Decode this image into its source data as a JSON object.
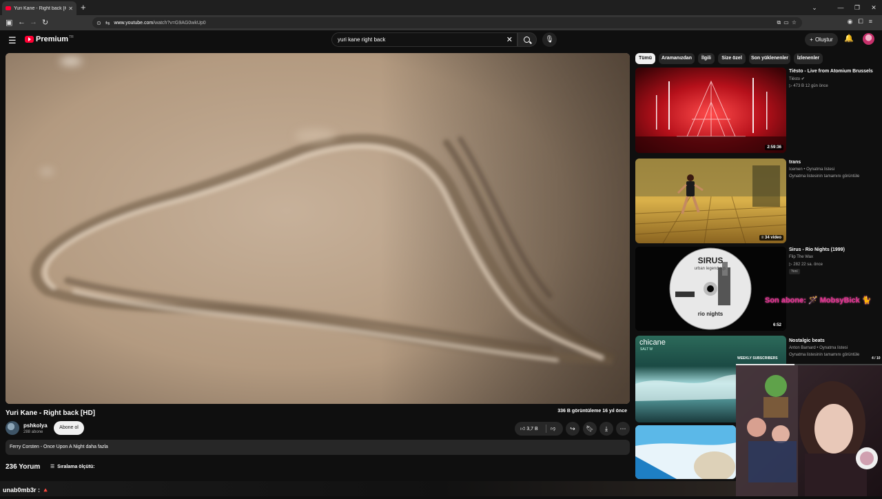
{
  "browser": {
    "tab_title": "Yuri Kane - Right back [HD] - Yo",
    "tab_close": "✕",
    "new_tab": "+",
    "url_host": "www.youtube.com",
    "url_path": "/watch?v=G9AG0wkUp0"
  },
  "header": {
    "logo_text": "Premium",
    "logo_sup": "TR",
    "search_value": "yuri kane right back",
    "clear_glyph": "✕",
    "create_label": "Oluştur"
  },
  "video": {
    "title": "Yuri Kane - Right back [HD]",
    "meta": "336 B görüntüleme  16 yıl önce",
    "channel_name": "pshkolya",
    "channel_subs": "288 abone",
    "subscribe_label": "Abone ol",
    "like_count": "3,7 B",
    "description": "Ferry Corsten - Once Upon A Night daha fazla",
    "comments_count": "236 Yorum",
    "sort_label": "Sıralama ölçütü:"
  },
  "chips": [
    "Tümü",
    "Aramanızdan",
    "İlgili",
    "Size özel",
    "Son yüklenenler",
    "İzlenenler"
  ],
  "recommendations": [
    {
      "title": "Tiësto - Live from Atomium Brussels",
      "channel": "Tiësto",
      "stats": "▷ 473 B   12 gün önce",
      "duration": "2:59:36"
    },
    {
      "title": "trans",
      "channel": "Icemen • Oynatma listesi",
      "stats": "Oynatma listesinin tamamını görüntüle",
      "duration": "34 video"
    },
    {
      "title": "Sirus - Rio Nights (1999)",
      "channel": "Flip The Wax",
      "stats": "▷ 282   22 sa. önce",
      "badge": "Yeni",
      "duration": "6:52"
    },
    {
      "title": "Nostalgic beats",
      "channel": "Anton Barnard • Oynatma listesi",
      "stats": "Oynatma listesinin tamamını görüntüle"
    }
  ],
  "thumb_text": {
    "sirus_logo": "SIRUS",
    "sirus_sub": "urban legend e.p.",
    "rio": "rio nights",
    "chicane": "chicane",
    "salt": "SALT W"
  },
  "overlay": {
    "last_sub": "Son abone: 🪄 MobsyBick 🐈",
    "weekly_label": "WEEKLY SUBSCRIBERS",
    "weekly_count": "4 / 10",
    "weekly_progress": 0.4,
    "chat_line": "unab0mb3r : 🔺"
  },
  "colors": {
    "accent_red": "#ff0033",
    "chip_bg": "#272727",
    "bg": "#0f0f0f",
    "overlay_pink": "#e0308f"
  }
}
